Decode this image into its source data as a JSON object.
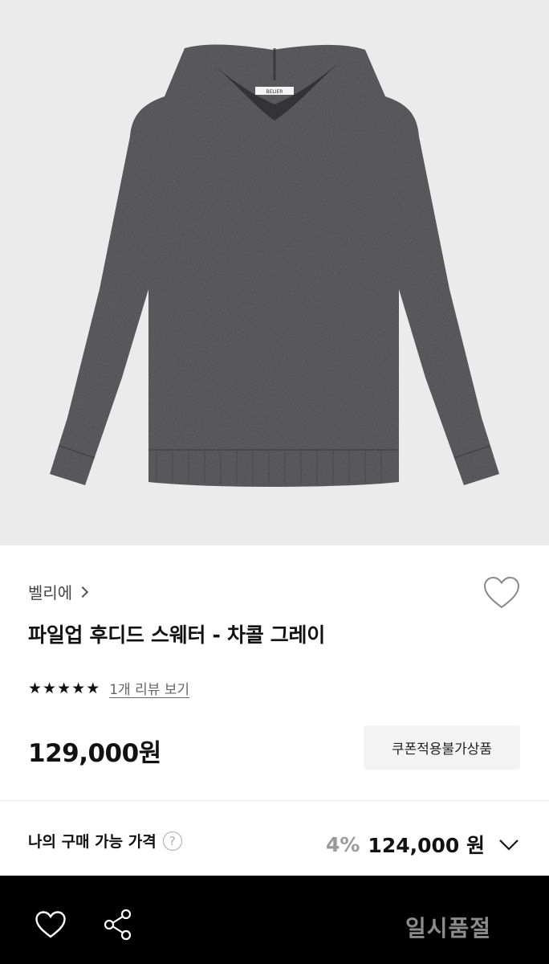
{
  "product": {
    "image_alt": "파일업 후디드 스웨터 - 차콜 그레이",
    "garment_label_text": "BELIER",
    "garment_color": "#3d3d3f",
    "background_color": "#ebebec"
  },
  "brand": {
    "name": "벨리에"
  },
  "title": "파일업 후디드 스웨터 - 차콜 그레이",
  "rating": {
    "stars": 5,
    "review_text": "1개 리뷰 보기"
  },
  "price": "129,000원",
  "coupon_badge": "쿠폰적용불가상품",
  "my_price": {
    "label": "나의 구매 가능 가격",
    "help_icon": "?",
    "discount_rate": "4%",
    "discount_price": "124,000 원"
  },
  "bottom_bar": {
    "sold_out_label": "일시품절",
    "icons": [
      "heart-icon",
      "share-icon"
    ]
  },
  "colors": {
    "bar_background": "#000000",
    "sold_out_text": "#8c8c8c",
    "discount_rate_text": "#9a9a9a"
  }
}
